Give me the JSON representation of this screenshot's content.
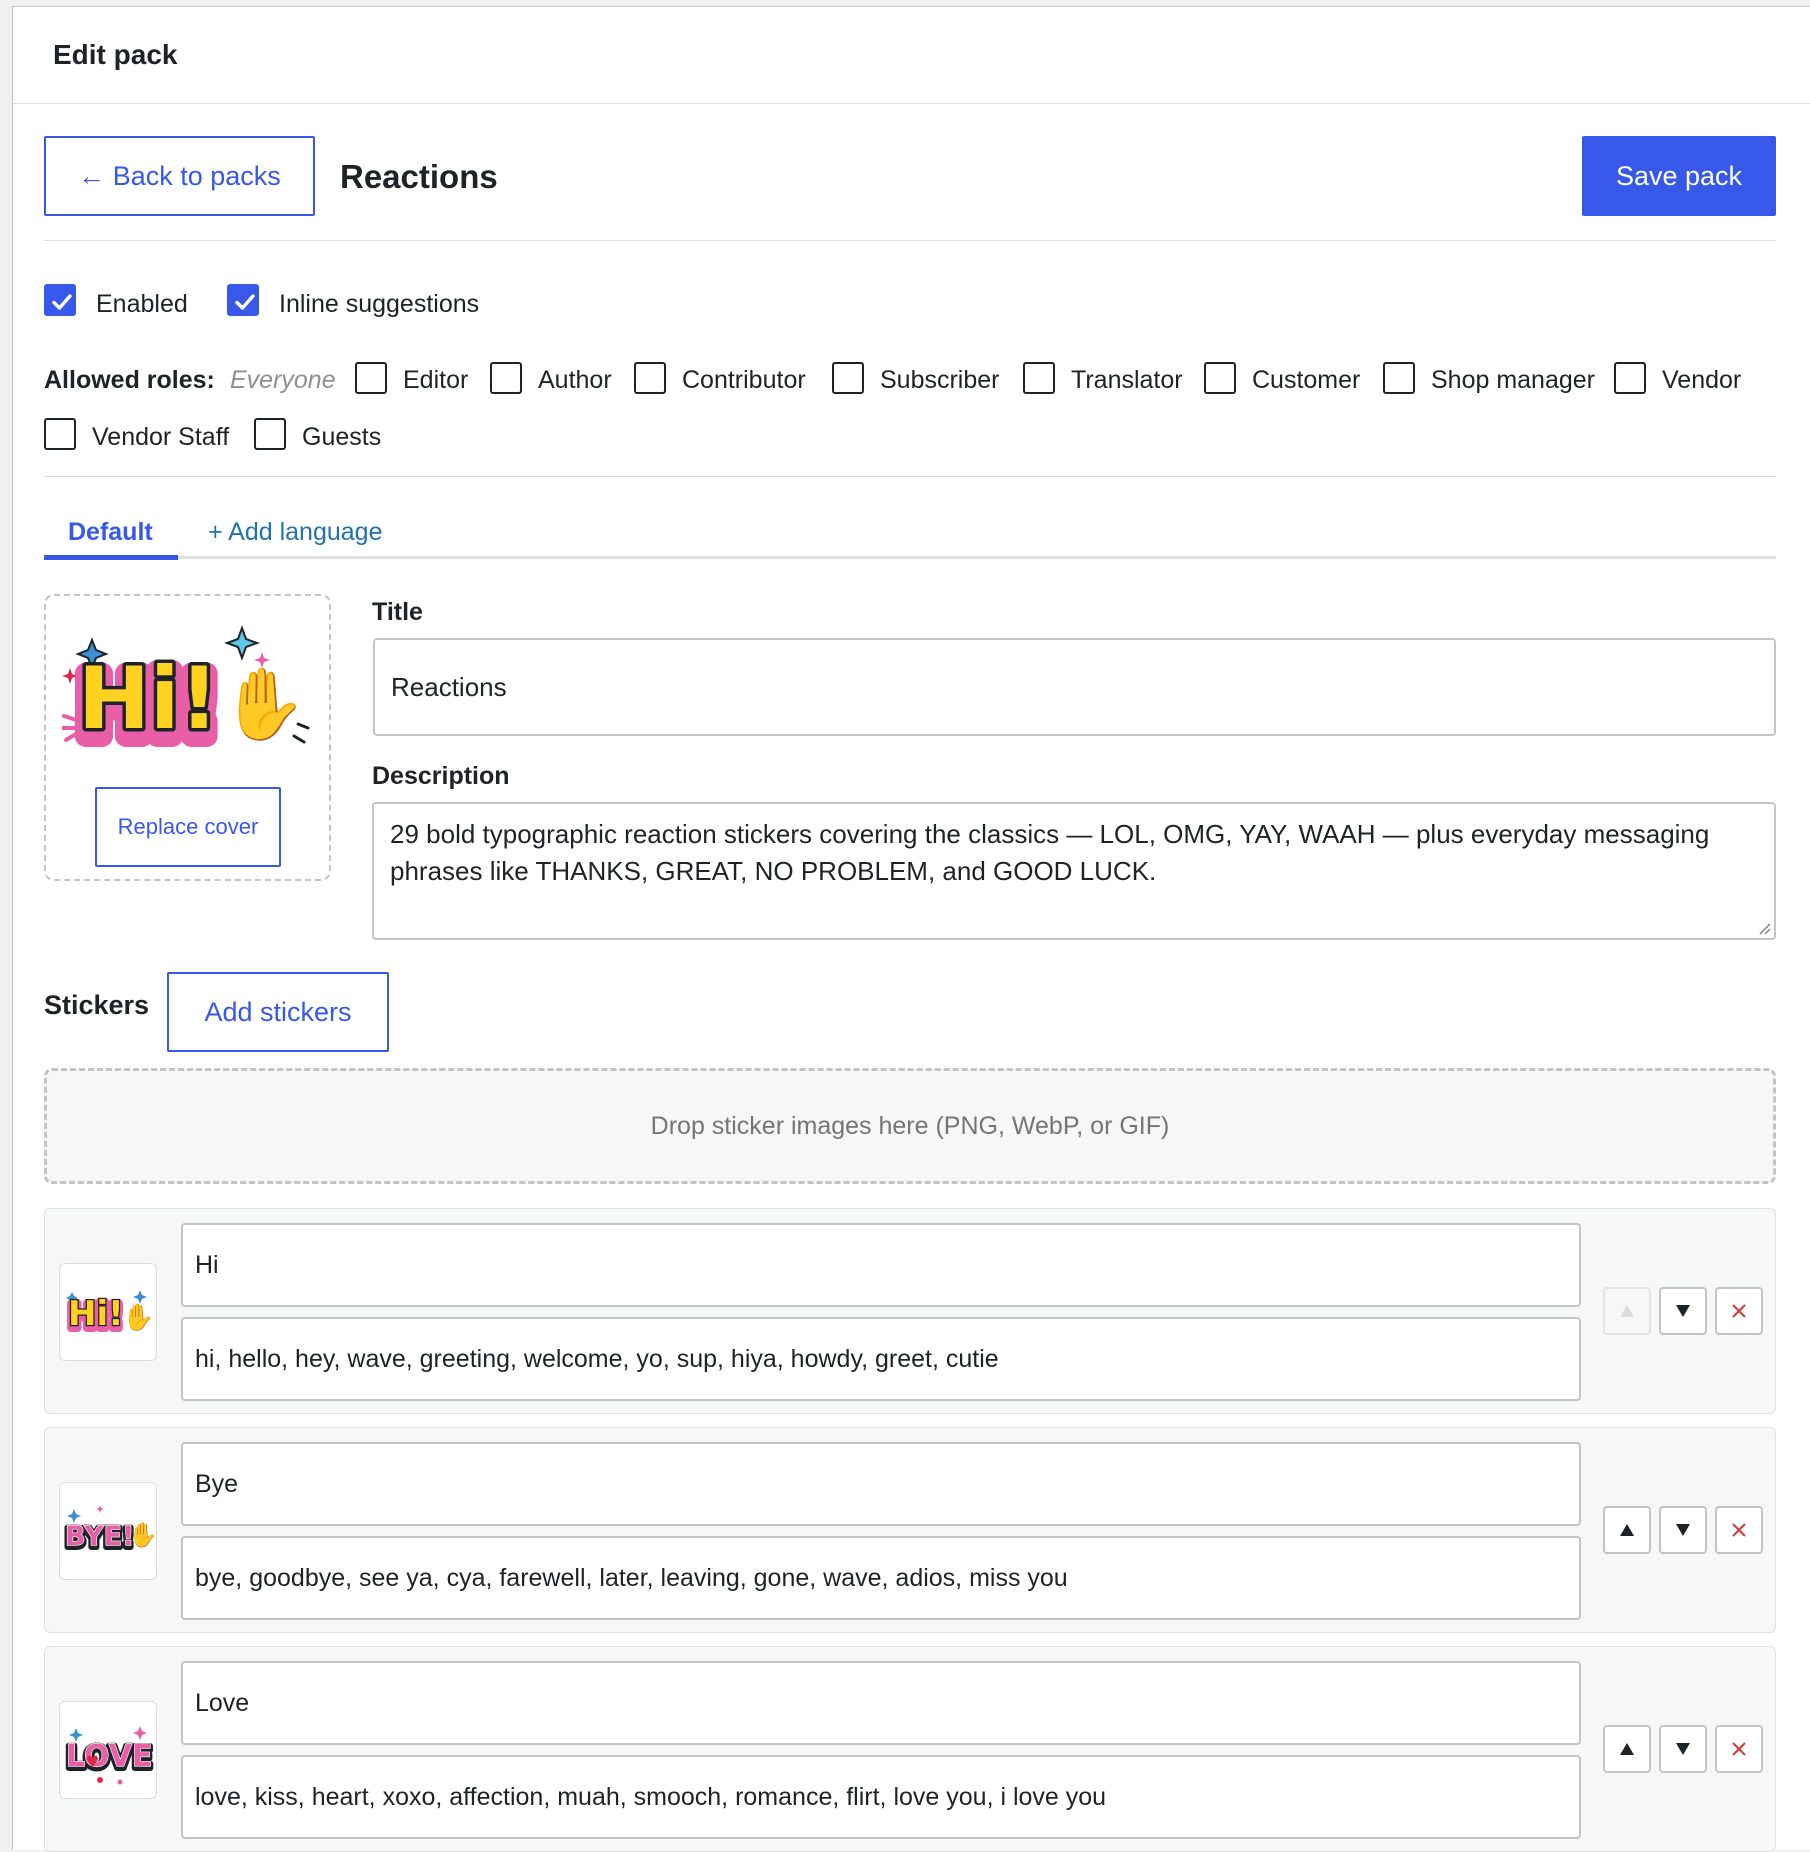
{
  "panel": {
    "title": "Edit pack"
  },
  "toolbar": {
    "back_label": "← Back to packs",
    "pack_name": "Reactions",
    "save_label": "Save pack"
  },
  "toggles": {
    "enabled": {
      "label": "Enabled",
      "checked": true
    },
    "inline": {
      "label": "Inline suggestions",
      "checked": true
    }
  },
  "roles": {
    "label": "Allowed roles:",
    "hint": "Everyone",
    "items": [
      {
        "label": "Editor",
        "checked": false
      },
      {
        "label": "Author",
        "checked": false
      },
      {
        "label": "Contributor",
        "checked": false
      },
      {
        "label": "Subscriber",
        "checked": false
      },
      {
        "label": "Translator",
        "checked": false
      },
      {
        "label": "Customer",
        "checked": false
      },
      {
        "label": "Shop manager",
        "checked": false
      },
      {
        "label": "Vendor",
        "checked": false
      },
      {
        "label": "Vendor Staff",
        "checked": false
      },
      {
        "label": "Guests",
        "checked": false
      }
    ]
  },
  "tabs": {
    "default_label": "Default",
    "add_language_label": "+ Add language"
  },
  "cover": {
    "image_text": "Hi!",
    "replace_label": "Replace cover"
  },
  "form": {
    "title_label": "Title",
    "title_value": "Reactions",
    "description_label": "Description",
    "description_value": "29 bold typographic reaction stickers covering the classics — LOL, OMG, YAY, WAAH — plus everyday messaging phrases like THANKS, GREAT, NO PROBLEM, and GOOD LUCK."
  },
  "stickers": {
    "label": "Stickers",
    "add_label": "Add stickers",
    "dropzone_text": "Drop sticker images here (PNG, WebP, or GIF)",
    "items": [
      {
        "image_text": "Hi!",
        "name": "Hi",
        "keywords": "hi, hello, hey, wave, greeting, welcome, yo, sup, hiya, howdy, greet, cutie",
        "can_move_up": false
      },
      {
        "image_text": "BYE!",
        "name": "Bye",
        "keywords": "bye, goodbye, see ya, cya, farewell, later, leaving, gone, wave, adios, miss you",
        "can_move_up": true
      },
      {
        "image_text": "LOVE",
        "name": "Love",
        "keywords": "love, kiss, heart, xoxo, affection, muah, smooch, romance, flirt, love you, i love you",
        "can_move_up": true
      }
    ]
  },
  "colors": {
    "accent": "#3858e9",
    "danger": "#d63638",
    "border": "#c3c4c7",
    "hi_yellow": "#ffd21f",
    "bye_pink": "#e85fa8",
    "love_red": "#e0264b"
  }
}
